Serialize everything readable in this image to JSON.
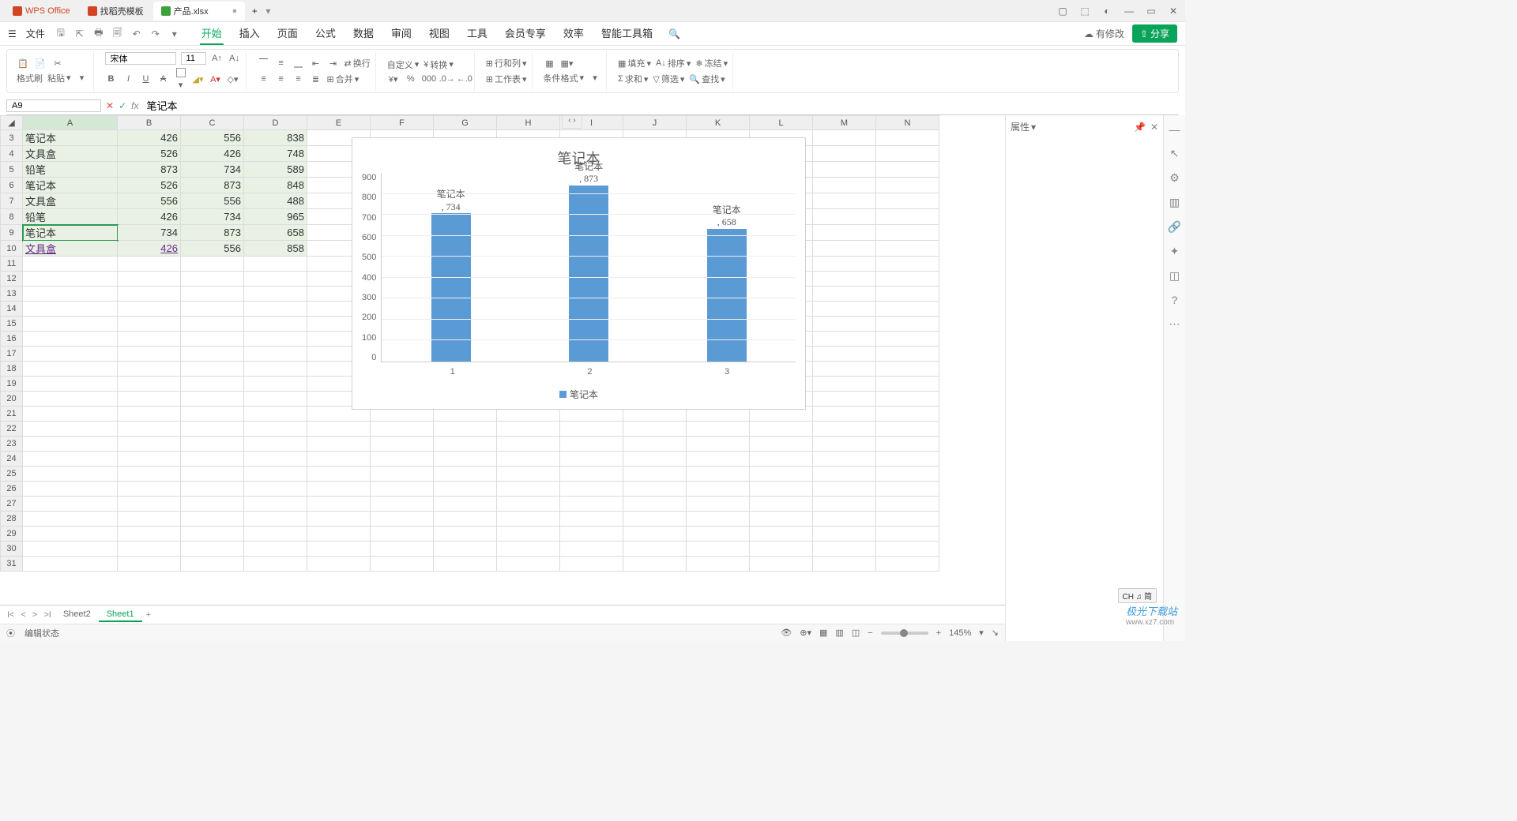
{
  "titlebar": {
    "app_name": "WPS Office",
    "tab_templates": "找稻壳模板",
    "tab_file": "产品.xlsx",
    "dirty_mark": "●",
    "add": "+"
  },
  "menubar": {
    "file": "文件",
    "tabs": [
      "开始",
      "插入",
      "页面",
      "公式",
      "数据",
      "审阅",
      "视图",
      "工具",
      "会员专享",
      "效率",
      "智能工具箱"
    ],
    "active_tab": "开始",
    "changes": "有修改",
    "share": "分享"
  },
  "ribbon": {
    "format_painter": "格式刷",
    "paste": "粘贴",
    "font_name": "宋体",
    "font_size": "11",
    "wrap_text": "换行",
    "merge": "合并",
    "custom": "自定义",
    "unit": "转换",
    "row_col": "行和列",
    "worksheet": "工作表",
    "cond_fmt": "条件格式",
    "fill": "填充",
    "sort": "排序",
    "freeze": "冻结",
    "sum": "求和",
    "filter": "筛选",
    "find": "查找"
  },
  "formula_bar": {
    "name_box": "A9",
    "fx_value": "笔记本"
  },
  "grid": {
    "columns": [
      "A",
      "B",
      "C",
      "D",
      "E",
      "F",
      "G",
      "H",
      "I",
      "J",
      "K",
      "L",
      "M",
      "N"
    ],
    "start_row": 3,
    "end_row": 31,
    "selected_cell": "A9",
    "data": {
      "3": {
        "A": "笔记本",
        "B": "426",
        "C": "556",
        "D": "838"
      },
      "4": {
        "A": "文具盒",
        "B": "526",
        "C": "426",
        "D": "748"
      },
      "5": {
        "A": "铅笔",
        "B": "873",
        "C": "734",
        "D": "589"
      },
      "6": {
        "A": "笔记本",
        "B": "526",
        "C": "873",
        "D": "848"
      },
      "7": {
        "A": "文具盒",
        "B": "556",
        "C": "556",
        "D": "488"
      },
      "8": {
        "A": "铅笔",
        "B": "426",
        "C": "734",
        "D": "965"
      },
      "9": {
        "A": "笔记本",
        "B": "734",
        "C": "873",
        "D": "658"
      },
      "10": {
        "A": "文具盒",
        "B": "426",
        "C": "556",
        "D": "858"
      }
    }
  },
  "chart_data": {
    "type": "bar",
    "title": "笔记本",
    "categories": [
      "1",
      "2",
      "3"
    ],
    "values": [
      734,
      873,
      658
    ],
    "series_name": "笔记本",
    "ylim": [
      0,
      900
    ],
    "ystep": 100,
    "data_labels": [
      ", 734",
      ", 873",
      ", 658"
    ],
    "label_title": "笔记本"
  },
  "sheet_tabs": {
    "tabs": [
      "Sheet2",
      "Sheet1"
    ],
    "active": "Sheet1",
    "add": "+"
  },
  "statusbar": {
    "mode": "编辑状态",
    "zoom": "145%",
    "ime": "CH ♫ 简"
  },
  "prop_panel": {
    "title": "属性"
  },
  "watermark": {
    "main": "极光下载站",
    "sub": "www.xz7.com"
  }
}
